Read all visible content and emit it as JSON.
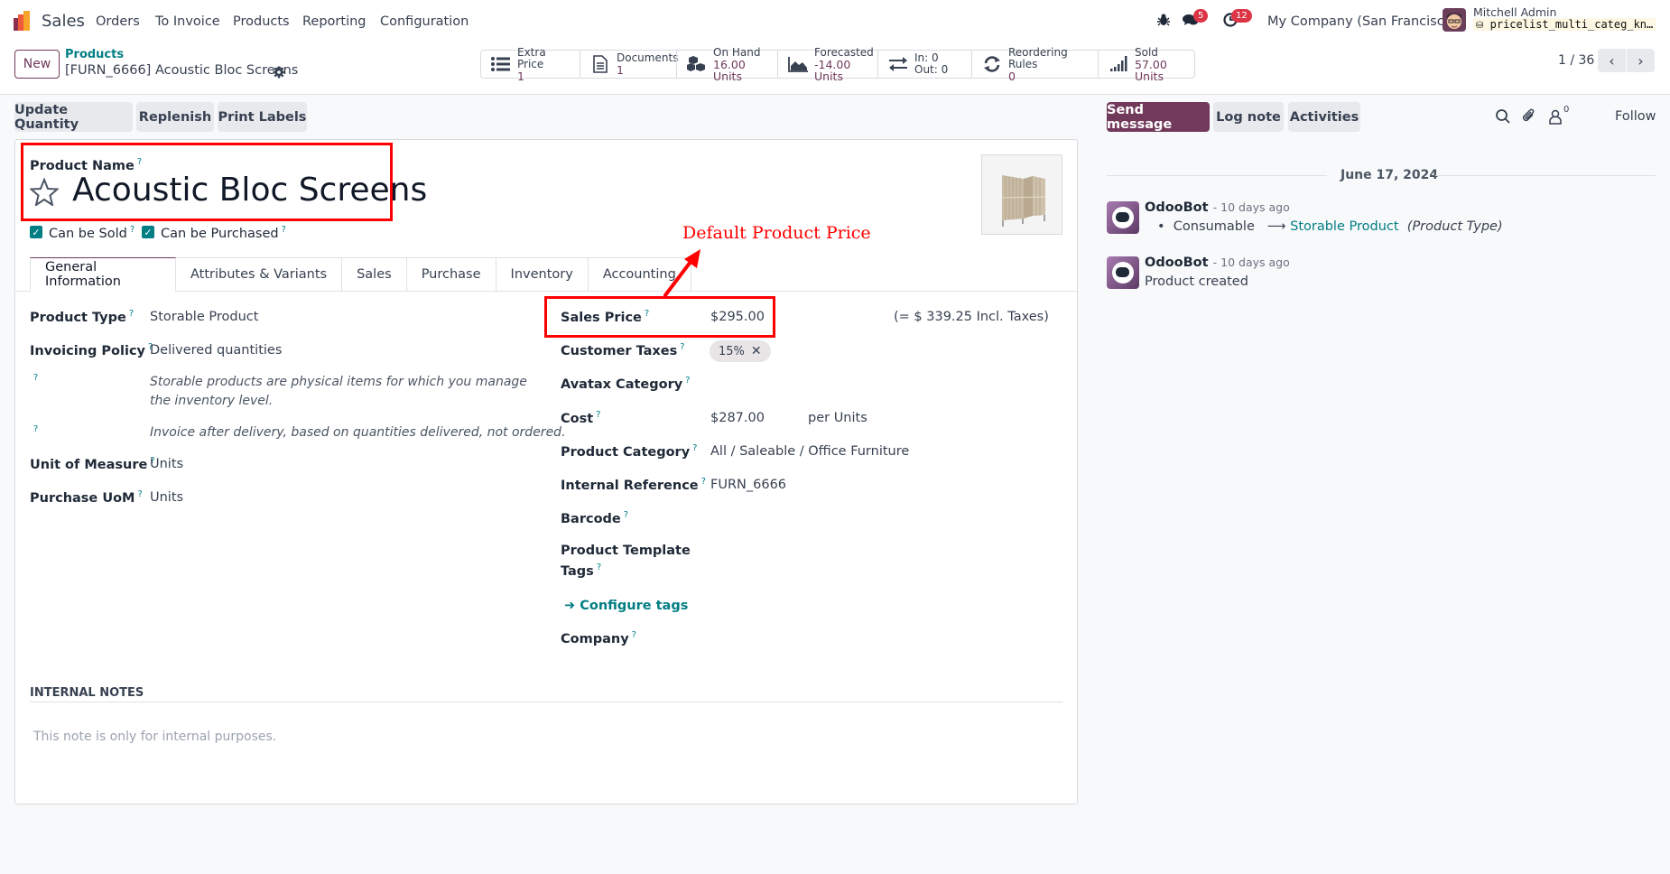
{
  "navbar": {
    "app_name": "Sales",
    "menu": [
      "Orders",
      "To Invoice",
      "Products",
      "Reporting",
      "Configuration"
    ],
    "icons": [
      "bug-icon",
      "chat-icon",
      "activity-clock-icon"
    ],
    "messages_badge": "5",
    "activities_badge": "12",
    "company": "My Company (San Francisco)",
    "user_name": "Mitchell Admin",
    "database": "pricelist_multi_categ_kn…"
  },
  "control_panel": {
    "new_label": "New",
    "breadcrumb_parent": "Products",
    "breadcrumb_current": "[FURN_6666] Acoustic Bloc Screens",
    "stats": [
      {
        "icon": "list-icon",
        "label": "Extra Price",
        "value": "1"
      },
      {
        "icon": "document-icon",
        "label": "Documents",
        "value": "1"
      },
      {
        "icon": "cubes-icon",
        "label": "On Hand",
        "value": "16.00 Units"
      },
      {
        "icon": "area-chart-icon",
        "label": "Forecasted",
        "value": "-14.00 Units"
      },
      {
        "icon": "exchange-icon",
        "label": "In: 0",
        "value": "Out: 0"
      },
      {
        "icon": "refresh-icon",
        "label": "Reordering Rules",
        "value": "0"
      },
      {
        "icon": "signal-icon",
        "label": "Sold",
        "value": "57.00 Units"
      }
    ],
    "pager": "1 / 36"
  },
  "actions": {
    "update_quantity": "Update Quantity",
    "replenish": "Replenish",
    "print_labels": "Print Labels"
  },
  "form": {
    "product_name_label": "Product Name",
    "product_name": "Acoustic Bloc Screens",
    "can_be_sold": "Can be Sold",
    "can_be_purchased": "Can be Purchased",
    "can_be_sold_checked": true,
    "can_be_purchased_checked": true,
    "tabs": [
      "General Information",
      "Attributes & Variants",
      "Sales",
      "Purchase",
      "Inventory",
      "Accounting"
    ],
    "active_tab": "General Information",
    "left_fields": {
      "product_type_label": "Product Type",
      "product_type": "Storable Product",
      "invoicing_policy_label": "Invoicing Policy",
      "invoicing_policy": "Delivered quantities",
      "hint_storable": "Storable products are physical items for which you manage the inventory level.",
      "hint_invoice": "Invoice after delivery, based on quantities delivered, not ordered.",
      "uom_label": "Unit of Measure",
      "uom": "Units",
      "purchase_uom_label": "Purchase UoM",
      "purchase_uom": "Units"
    },
    "right_fields": {
      "sales_price_label": "Sales Price",
      "sales_price": "$295.00",
      "incl_taxes": "(= $ 339.25 Incl. Taxes)",
      "customer_taxes_label": "Customer Taxes",
      "customer_tax_tag": "15%",
      "avatax_label": "Avatax Category",
      "cost_label": "Cost",
      "cost": "$287.00",
      "cost_unit": "per Units",
      "category_label": "Product Category",
      "category": "All / Saleable / Office Furniture",
      "internal_ref_label": "Internal Reference",
      "internal_ref": "FURN_6666",
      "barcode_label": "Barcode",
      "template_tags_label_1": "Product Template",
      "template_tags_label_2": "Tags",
      "configure_tags": "Configure tags",
      "company_label": "Company"
    },
    "help_mark": "?",
    "internal_notes_title": "INTERNAL NOTES",
    "internal_notes_placeholder": "This note is only for internal purposes."
  },
  "annotation": {
    "text": "Default Product Price",
    "color": "#ff0000"
  },
  "chatter": {
    "send_message": "Send message",
    "log_note": "Log note",
    "activities": "Activities",
    "followers_count": "0",
    "follow": "Follow",
    "date": "June 17, 2024",
    "messages": [
      {
        "author": "OdooBot",
        "ago": "- 10 days ago",
        "old_value": "Consumable",
        "new_value": "Storable Product",
        "field": "(Product Type)"
      },
      {
        "author": "OdooBot",
        "ago": "- 10 days ago",
        "body": "Product created"
      }
    ]
  },
  "colors": {
    "brand": "#71395a",
    "link": "#017e84",
    "badge": "#dc3545"
  }
}
